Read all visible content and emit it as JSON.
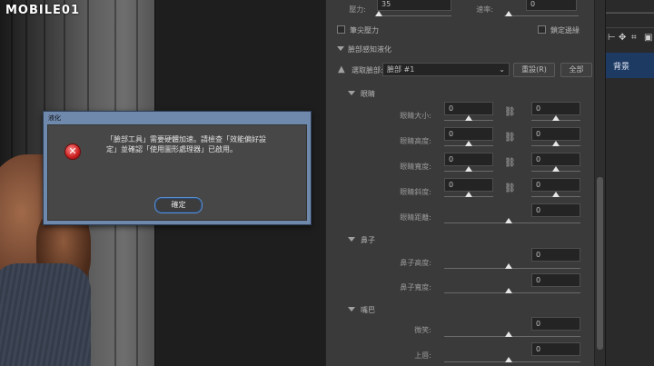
{
  "watermark": "MOBILE01",
  "pressure": {
    "label": "壓力:",
    "value": "35",
    "rate_label": "速率:",
    "rate_value": "0"
  },
  "options": {
    "stylus_pressure": "筆尖壓力",
    "pin_edges": "鎖定邊緣"
  },
  "face_aware": {
    "section": "臉部感知液化",
    "select_face_label": "選取臉部:",
    "select_face_value": "臉部 #1",
    "reset_button": "重設(R)",
    "all_button": "全部"
  },
  "eyes": {
    "heading": "眼睛",
    "rows": [
      {
        "label": "眼睛大小:",
        "left": "0",
        "right": "0"
      },
      {
        "label": "眼睛高度:",
        "left": "0",
        "right": "0"
      },
      {
        "label": "眼睛寬度:",
        "left": "0",
        "right": "0"
      },
      {
        "label": "眼睛斜度:",
        "left": "0",
        "right": "0"
      }
    ],
    "distance": {
      "label": "眼睛距離:",
      "value": "0"
    }
  },
  "nose": {
    "heading": "鼻子",
    "rows": [
      {
        "label": "鼻子高度:",
        "value": "0"
      },
      {
        "label": "鼻子寬度:",
        "value": "0"
      }
    ]
  },
  "mouth": {
    "heading": "嘴巴",
    "rows": [
      {
        "label": "微笑:",
        "value": "0"
      },
      {
        "label": "上唇:",
        "value": "0"
      }
    ]
  },
  "layers": {
    "layer_name": "背景",
    "icons": [
      "move-icon",
      "crop-icon"
    ]
  },
  "dialog": {
    "title": "液化",
    "message_line1": "「臉部工具」需要硬體加速。請檢查「效能偏好設",
    "message_line2": "定」並確認「使用圖形處理器」已啟用。",
    "ok_label": "確定",
    "icon": "error-icon"
  }
}
